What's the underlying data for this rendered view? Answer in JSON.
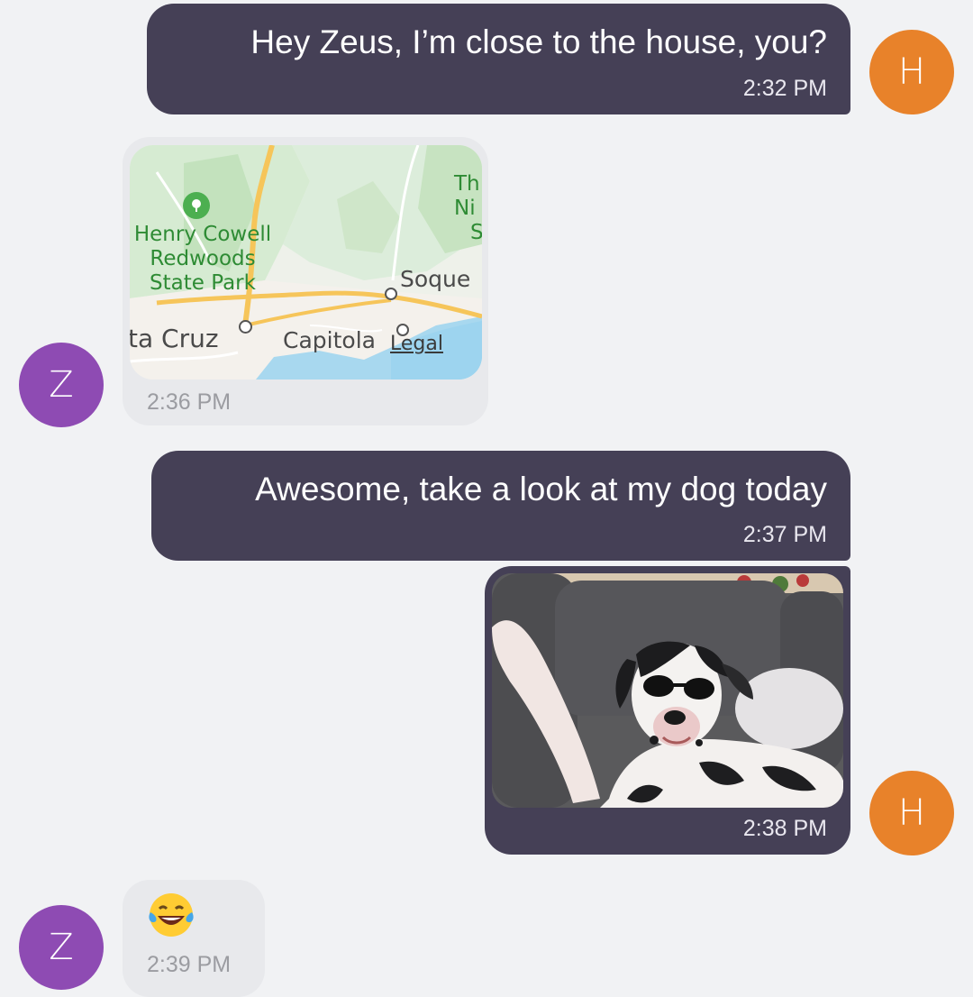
{
  "messages": [
    {
      "sender": "H",
      "text": "Hey Zeus, I’m close to the house, you?",
      "time": "2:32 PM"
    },
    {
      "sender": "Z",
      "type": "map",
      "time": "2:36 PM"
    },
    {
      "sender": "H",
      "text": "Awesome, take a look at my dog today",
      "time": "2:37 PM"
    },
    {
      "sender": "H",
      "type": "photo",
      "time": "2:38 PM"
    },
    {
      "sender": "Z",
      "type": "emoji",
      "emoji": "😂",
      "time": "2:39 PM"
    }
  ],
  "map": {
    "labels": {
      "park1": "Henry Cowell",
      "park2": "Redwoods",
      "park3": "State Park",
      "city1": "ta Cruz",
      "city2": "Capitola",
      "city3": "Soque",
      "corner1": "Th",
      "corner2": "Ni",
      "corner3": "S",
      "legal": "Legal"
    }
  },
  "avatars": {
    "h": "H",
    "z": "Z"
  },
  "colors": {
    "outgoing_bubble": "#454056",
    "incoming_bubble": "#e8e9ec",
    "avatar_h": "#e8822a",
    "avatar_z": "#8e4bb3",
    "background": "#f1f2f4"
  },
  "icons": [
    "park-tree-icon",
    "city-marker-icon"
  ]
}
